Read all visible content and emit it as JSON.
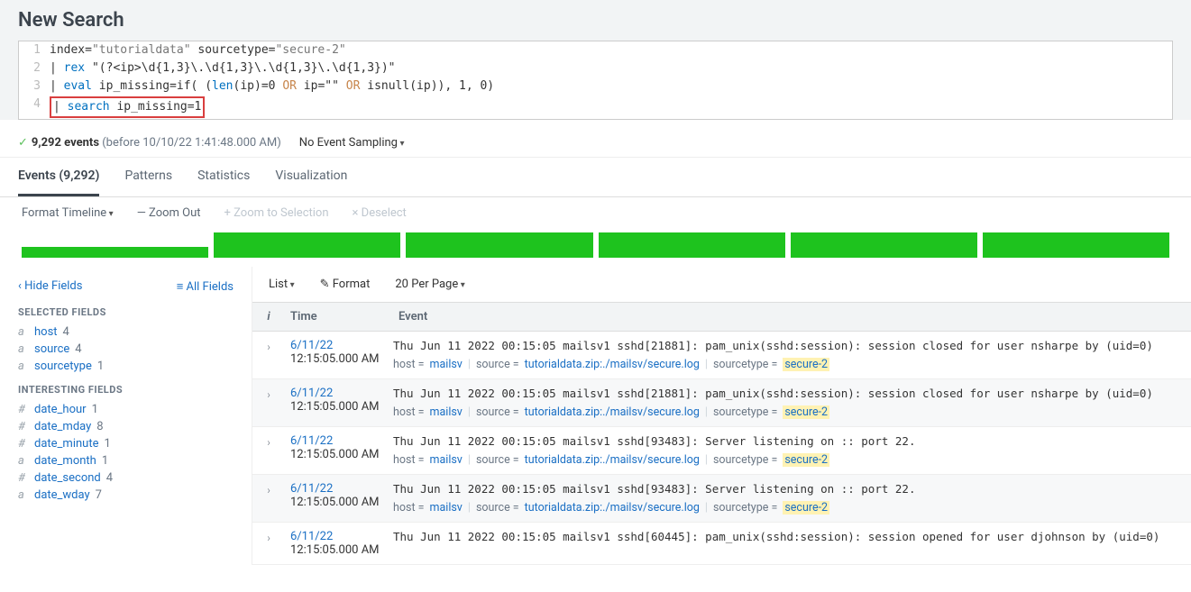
{
  "title": "New Search",
  "query": {
    "lines": [
      {
        "n": "1",
        "raw": "index=\"tutorialdata\" sourcetype=\"secure-2\""
      },
      {
        "n": "2",
        "raw": "| rex \"(?<ip>\\d{1,3}\\.\\d{1,3}\\.\\d{1,3}\\.\\d{1,3})\""
      },
      {
        "n": "3",
        "raw": "| eval ip_missing=if( (len(ip)=0 OR ip=\"\" OR isnull(ip)), 1, 0)"
      },
      {
        "n": "4",
        "raw": "| search ip_missing=1"
      }
    ]
  },
  "results": {
    "count_label": "9,292 events",
    "timestamp": "(before 10/10/22 1:41:48.000 AM)",
    "sampling": "No Event Sampling"
  },
  "tabs": {
    "events": "Events (9,292)",
    "patterns": "Patterns",
    "statistics": "Statistics",
    "visualization": "Visualization"
  },
  "timeline_toolbar": {
    "format": "Format Timeline",
    "zoom_out": "— Zoom Out",
    "zoom_sel": "+ Zoom to Selection",
    "deselect": "× Deselect"
  },
  "side": {
    "hide": "Hide Fields",
    "all": "All Fields",
    "selected_heading": "SELECTED FIELDS",
    "interesting_heading": "INTERESTING FIELDS",
    "selected": [
      {
        "t": "a",
        "name": "host",
        "count": "4"
      },
      {
        "t": "a",
        "name": "source",
        "count": "4"
      },
      {
        "t": "a",
        "name": "sourcetype",
        "count": "1"
      }
    ],
    "interesting": [
      {
        "t": "#",
        "name": "date_hour",
        "count": "1"
      },
      {
        "t": "#",
        "name": "date_mday",
        "count": "8"
      },
      {
        "t": "#",
        "name": "date_minute",
        "count": "1"
      },
      {
        "t": "a",
        "name": "date_month",
        "count": "1"
      },
      {
        "t": "#",
        "name": "date_second",
        "count": "4"
      },
      {
        "t": "a",
        "name": "date_wday",
        "count": "7"
      }
    ]
  },
  "list_toolbar": {
    "view": "List",
    "format": "Format",
    "perpage": "20 Per Page"
  },
  "table_head": {
    "i": "i",
    "time": "Time",
    "event": "Event"
  },
  "meta_labels": {
    "host": "host =",
    "source": "source =",
    "sourcetype": "sourcetype ="
  },
  "events": [
    {
      "date": "6/11/22",
      "time": "12:15:05.000 AM",
      "raw": "Thu Jun 11 2022 00:15:05 mailsv1 sshd[21881]: pam_unix(sshd:session): session closed for user nsharpe by (uid=0)",
      "host": "mailsv",
      "source": "tutorialdata.zip:./mailsv/secure.log",
      "sourcetype": "secure-2"
    },
    {
      "date": "6/11/22",
      "time": "12:15:05.000 AM",
      "raw": "Thu Jun 11 2022 00:15:05 mailsv1 sshd[21881]: pam_unix(sshd:session): session closed for user nsharpe by (uid=0)",
      "host": "mailsv",
      "source": "tutorialdata.zip:./mailsv/secure.log",
      "sourcetype": "secure-2"
    },
    {
      "date": "6/11/22",
      "time": "12:15:05.000 AM",
      "raw": "Thu Jun 11 2022 00:15:05 mailsv1 sshd[93483]: Server listening on :: port 22.",
      "host": "mailsv",
      "source": "tutorialdata.zip:./mailsv/secure.log",
      "sourcetype": "secure-2"
    },
    {
      "date": "6/11/22",
      "time": "12:15:05.000 AM",
      "raw": "Thu Jun 11 2022 00:15:05 mailsv1 sshd[93483]: Server listening on :: port 22.",
      "host": "mailsv",
      "source": "tutorialdata.zip:./mailsv/secure.log",
      "sourcetype": "secure-2"
    },
    {
      "date": "6/11/22",
      "time": "12:15:05.000 AM",
      "raw": "Thu Jun 11 2022 00:15:05 mailsv1 sshd[60445]: pam_unix(sshd:session): session opened for user djohnson by (uid=0)",
      "host": "mailsv",
      "source": "tutorialdata.zip:./mailsv/secure.log",
      "sourcetype": "secure-2"
    }
  ]
}
